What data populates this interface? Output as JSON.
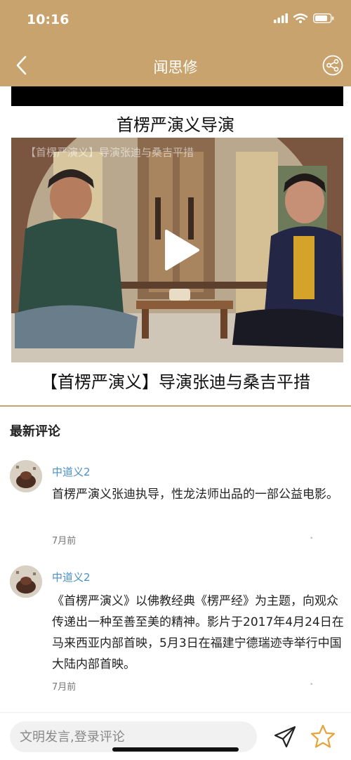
{
  "status_bar": {
    "time": "10:16"
  },
  "nav": {
    "title": "闻思修"
  },
  "video": {
    "heading": "首楞严演义导演",
    "overlay_title": "【首楞严演义】导演张迪与桑吉平措",
    "caption": "【首楞严演义】导演张迪与桑吉平措"
  },
  "comments": {
    "section_title": "最新评论",
    "items": [
      {
        "user": "中道义2",
        "text": "首楞严演义张迪执导，性龙法师出品的一部公益电影。",
        "time": "7月前"
      },
      {
        "user": "中道义2",
        "text": "《首楞严演义》以佛教经典《楞严经》为主题，向观众传递出一种至善至美的精神。影片于2017年4月24日在马来西亚内部首映，5月3日在福建宁德瑞迹寺举行中国大陆内部首映。",
        "time": "7月前"
      }
    ]
  },
  "bottom_bar": {
    "input_placeholder": "文明发言,登录评论"
  },
  "colors": {
    "header": "#c9a36d",
    "username": "#4a90c8",
    "star": "#e8a33a"
  },
  "icons": [
    "back-icon",
    "share-icon",
    "play-icon",
    "send-icon",
    "star-icon",
    "signal-icon",
    "wifi-icon",
    "battery-icon"
  ]
}
